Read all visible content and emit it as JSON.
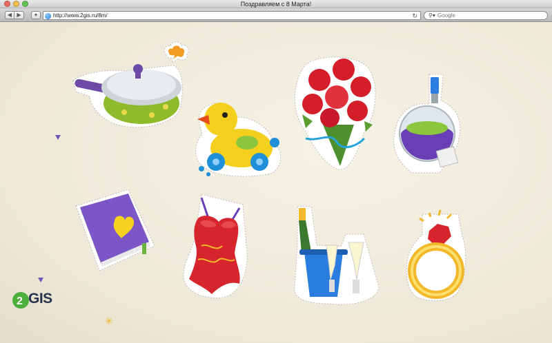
{
  "window": {
    "title": "Поздравляем с 8 Марта!"
  },
  "toolbar": {
    "back_icon": "◀",
    "forward_icon": "▶",
    "add_icon": "+",
    "url": "http://www.2gis.ru/8m/",
    "reload_icon": "↻",
    "search_placeholder": "Google",
    "search_icon": "🔍"
  },
  "page": {
    "logo_text": "GIS",
    "stickers": [
      "frying-pan",
      "rubber-duck",
      "rose-bouquet",
      "perfume-bottle",
      "diary-book",
      "red-corset",
      "champagne-bucket",
      "diamond-ring"
    ]
  }
}
